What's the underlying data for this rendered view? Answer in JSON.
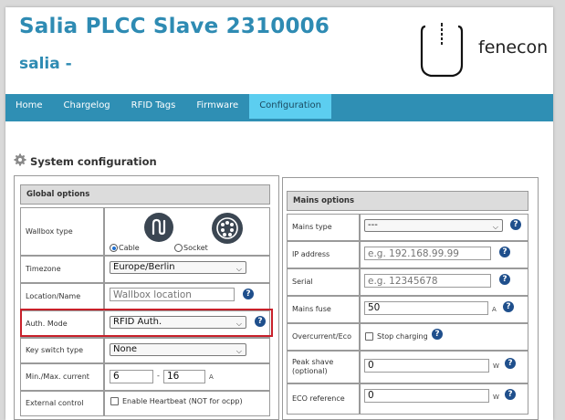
{
  "header": {
    "title": "Salia PLCC Slave",
    "serial": "2310006",
    "subtitle": "salia -",
    "logo_text": "fenecon"
  },
  "nav": {
    "items": [
      "Home",
      "Chargelog",
      "RFID Tags",
      "Firmware",
      "Configuration"
    ],
    "active": "Configuration"
  },
  "section": {
    "title": "System configuration",
    "icon": "gear-icon"
  },
  "global_options": {
    "heading": "Global options",
    "wallbox_type": {
      "label": "Wallbox type",
      "options": [
        "Cable",
        "Socket"
      ],
      "selected": "Cable"
    },
    "timezone": {
      "label": "Timezone",
      "value": "Europe/Berlin"
    },
    "location": {
      "label": "Location/Name",
      "placeholder": "Wallbox location"
    },
    "auth_mode": {
      "label": "Auth. Mode",
      "value": "RFID Auth."
    },
    "key_switch": {
      "label": "Key switch type",
      "value": "None"
    },
    "current": {
      "label": "Min./Max. current",
      "min": "6",
      "separator": "-",
      "max": "16",
      "unit": "A"
    },
    "external_control": {
      "label": "External control",
      "checkbox_label": "Enable Heartbeat (NOT for ocpp)"
    }
  },
  "mains_options": {
    "heading": "Mains options",
    "mains_type": {
      "label": "Mains type",
      "value": "---"
    },
    "ip_address": {
      "label": "IP address",
      "placeholder": "e.g. 192.168.99.99"
    },
    "serial": {
      "label": "Serial",
      "placeholder": "e.g. 12345678"
    },
    "mains_fuse": {
      "label": "Mains fuse",
      "value": "50",
      "unit": "A"
    },
    "overcurrent": {
      "label": "Overcurrent/Eco",
      "checkbox_label": "Stop charging"
    },
    "peak_shave": {
      "label": "Peak shave (optional)",
      "value": "0",
      "unit": "W"
    },
    "eco_reference": {
      "label": "ECO reference",
      "value": "0",
      "unit": "W"
    }
  },
  "colors": {
    "brand": "#2e8bb3",
    "nav_bg": "#2f8fb4",
    "nav_active": "#5ccef0",
    "help_icon": "#1f4f8c",
    "highlight": "#c8202a"
  }
}
